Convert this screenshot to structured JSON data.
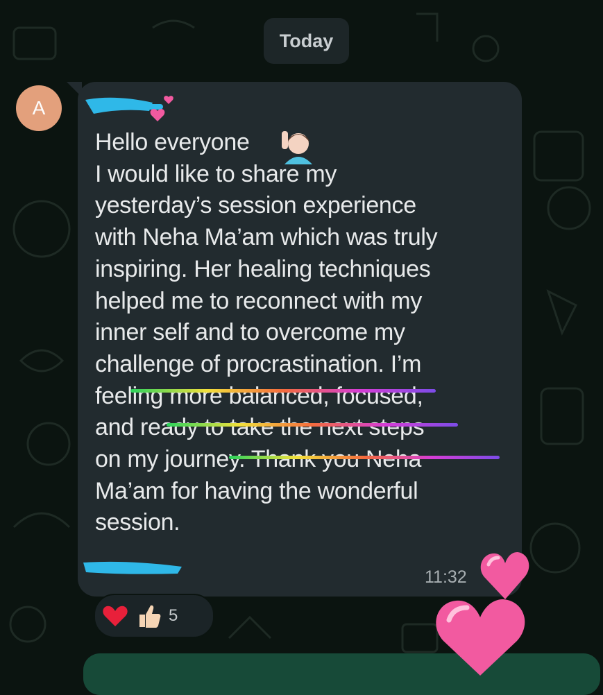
{
  "date_chip": "Today",
  "avatar_initial": "A",
  "message": {
    "text": "Hello everyone \nI would like to share my\nyesterday’s session experience\nwith Neha Ma’am which was truly\ninspiring. Her healing techniques\nhelped me to reconnect with my\ninner self and to overcome my\nchallenge of procrastination. I’m\nfeeling more balanced, focused,\nand ready to take the next steps\non my journey. Thank you Neha\nMa’am for having the wonderful\nsession.",
    "time": "11:32"
  },
  "reactions": {
    "count": "5",
    "icons": [
      "heart-emoji",
      "thumbs-up-emoji"
    ]
  },
  "colors": {
    "bubble": "#222b2f",
    "avatar": "#e3a07c",
    "sender_redaction": "#2fb8e8",
    "heart_sticker": "#f25aa0",
    "next_bubble": "#174a38"
  }
}
